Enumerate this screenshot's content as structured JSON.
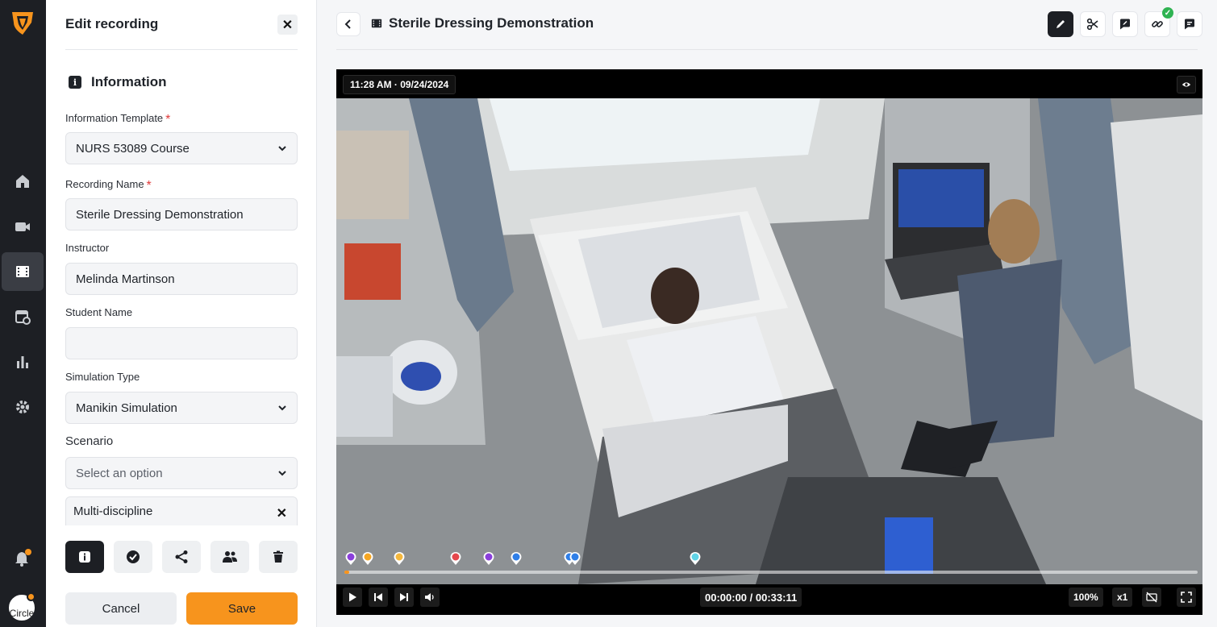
{
  "panel": {
    "title": "Edit recording",
    "section_title": "Information",
    "fields": {
      "template_label": "Information Template",
      "template_value": "NURS 53089 Course",
      "recording_name_label": "Recording Name",
      "recording_name_value": "Sterile Dressing Demonstration",
      "instructor_label": "Instructor",
      "instructor_value": "Melinda Martinson",
      "student_label": "Student Name",
      "student_value": "",
      "simulation_type_label": "Simulation Type",
      "simulation_type_value": "Manikin Simulation",
      "scenario_label": "Scenario",
      "scenario_placeholder": "Select an option",
      "chip": "Multi-discipline"
    },
    "required_mark": "*",
    "close_glyph": "✕",
    "chip_remove_glyph": "✕",
    "cancel_label": "Cancel",
    "save_label": "Save"
  },
  "rail": {
    "avatar_text": "Circle",
    "items": [
      "home-icon",
      "video-camera-icon",
      "film-icon",
      "schedule-icon",
      "chart-icon",
      "gear-icon"
    ]
  },
  "header": {
    "title": "Sterile Dressing Demonstration"
  },
  "video": {
    "timestamp": "11:28 AM · 09/24/2024",
    "time_display": "00:00:00 / 00:33:11",
    "zoom": "100%",
    "speed": "x1",
    "progress_fraction": 0.0,
    "markers": [
      {
        "color": "#8b3fdc"
      },
      {
        "color": "#f5a623"
      },
      {
        "color": "#f5b83d"
      },
      {
        "color": "#e5484d"
      },
      {
        "color": "#8b3fdc"
      },
      {
        "color": "#2f7fe8"
      },
      {
        "color": "#2f7fe8"
      },
      {
        "color": "#2f7fe8"
      },
      {
        "color": "#5fd3e6"
      }
    ]
  },
  "colors": {
    "accent": "#f7941d",
    "rail_bg": "#1d1f24",
    "success": "#2fb352"
  }
}
